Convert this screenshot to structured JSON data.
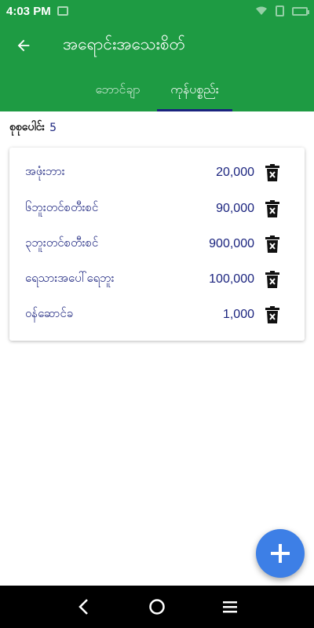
{
  "status_bar": {
    "time": "4:03 PM"
  },
  "app_bar": {
    "title": "အရောင်းအသေးစိတ်"
  },
  "tabs": [
    {
      "label": "ဘောင်ချာ"
    },
    {
      "label": "ကုန်ပစ္စည်း"
    }
  ],
  "summary": {
    "label": "စုစုပေါင်း",
    "count": "5"
  },
  "items": [
    {
      "name": "အဖုံးဘား",
      "amount": "20,000"
    },
    {
      "name": "၆ဘူးတင်စတီးစင်",
      "amount": "90,000"
    },
    {
      "name": "၃ဘူးတင်စတီးစင်",
      "amount": "900,000"
    },
    {
      "name": "ရေသားအပေါ်ရေဘူး",
      "amount": "100,000"
    },
    {
      "name": "ဝန်ဆောင်ခ",
      "amount": "1,000"
    }
  ],
  "colors": {
    "primary": "#1e9b43",
    "accent": "#1a237e",
    "fab": "#3d7fe6"
  },
  "icons": {
    "back": "arrow-left-icon",
    "delete": "trash-icon",
    "add": "plus-icon"
  }
}
